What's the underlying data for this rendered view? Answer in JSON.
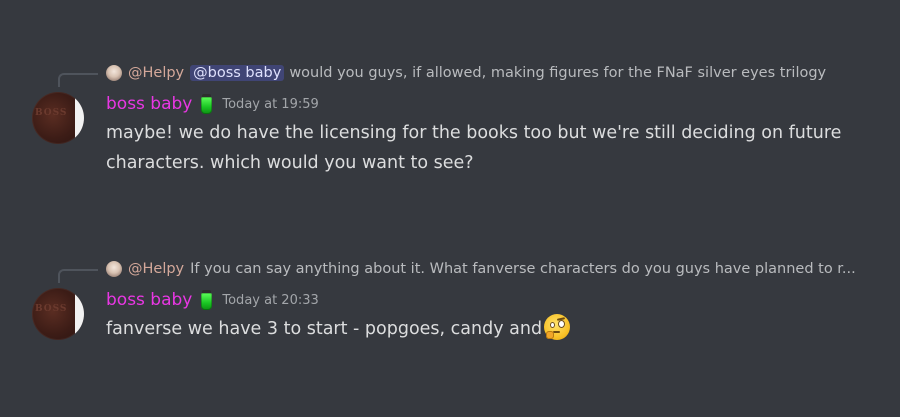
{
  "messages": [
    {
      "reply": {
        "author": "@Helpy",
        "mention": "@boss baby",
        "text": "would you guys, if allowed, making figures for the FNaF silver eyes trilogy"
      },
      "author": "boss baby",
      "timestamp": "Today at 19:59",
      "avatar_text": "BOSS",
      "content": "maybe! we do have the licensing for the books too but we're still deciding on future characters. which would you want to see?"
    },
    {
      "reply": {
        "author": "@Helpy",
        "text": "If you can say anything about it. What fanverse characters do you guys have planned to r..."
      },
      "author": "boss baby",
      "timestamp": "Today at 20:33",
      "avatar_text": "BOSS",
      "content": "fanverse we have 3 to start - popgoes, candy and"
    }
  ],
  "colors": {
    "background": "#36393f",
    "author": "#e837e3",
    "reply_author": "#d4a89a",
    "mention_bg": "#4b5190",
    "text": "#dcddde",
    "timestamp": "#a3a6aa"
  },
  "icons": {
    "role": "green-potion-icon",
    "emoji": "face-with-raised-eyebrow-hand-emoji"
  }
}
